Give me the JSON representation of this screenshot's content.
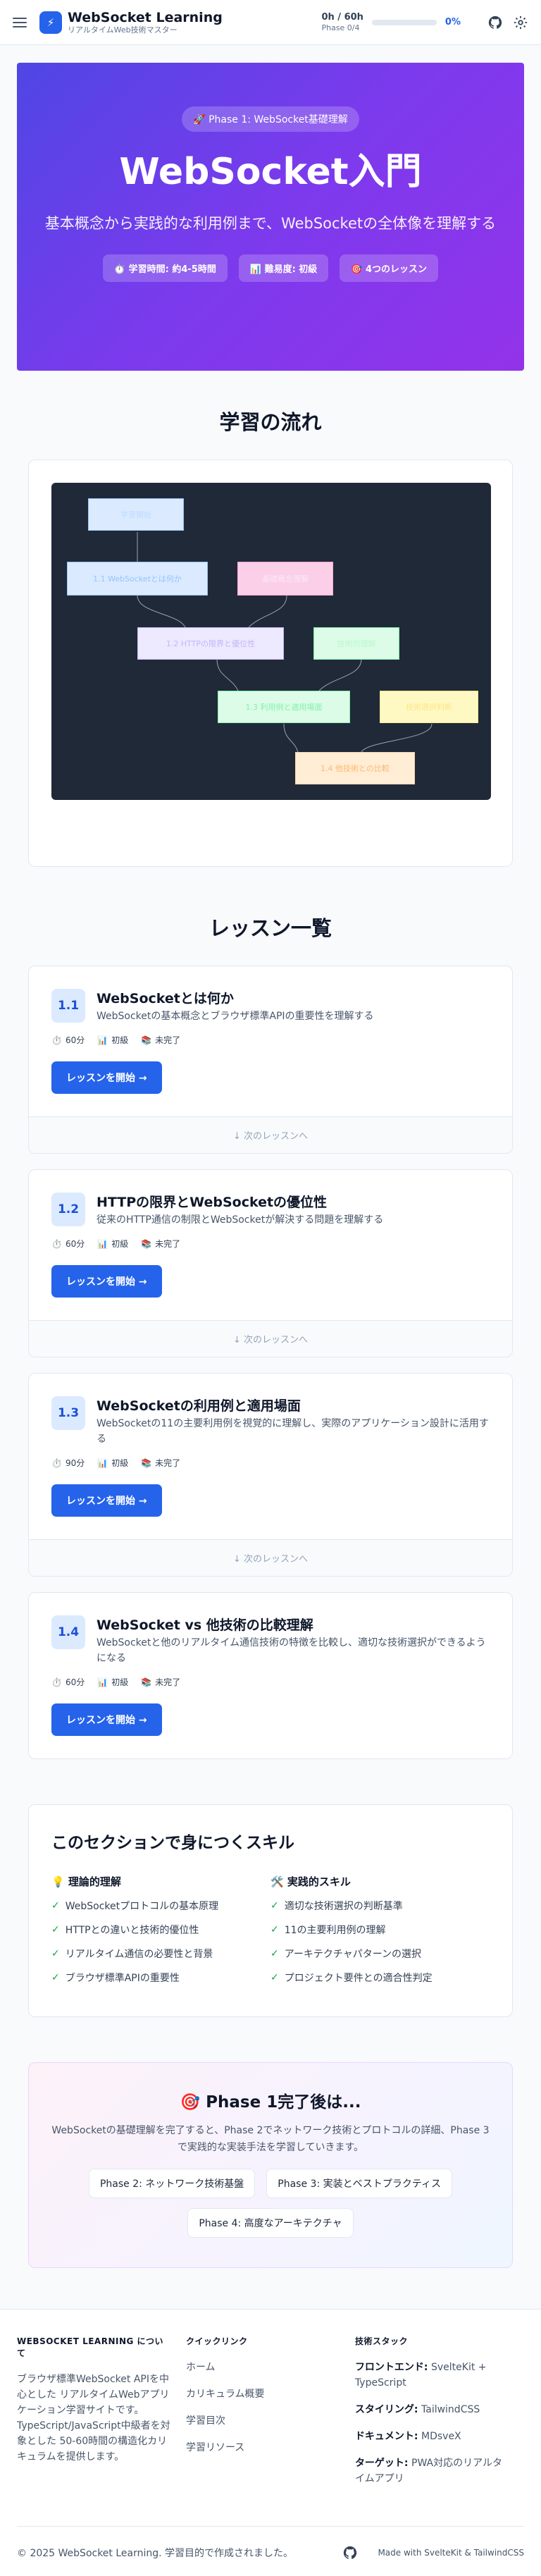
{
  "header": {
    "brand_title": "WebSocket Learning",
    "brand_sub": "リアルタイムWeb技術マスター",
    "hours": "0h / 60h",
    "phase": "Phase 0/4",
    "progress_pct": 0,
    "progress_label": "0%",
    "icons": [
      "menu-icon",
      "bolt-icon",
      "github-icon",
      "gear-icon"
    ]
  },
  "hero": {
    "badge": "🚀 Phase 1: WebSocket基礎理解",
    "title": "WebSocket入門",
    "subtitle": "基本概念から実践的な利用例まで、WebSocketの全体像を理解する",
    "stats": [
      "⏱️ 学習時間: 約4-5時間",
      "📊 難易度: 初級",
      "🎯 4つのレッスン"
    ]
  },
  "flow": {
    "title": "学習の流れ",
    "nodes": [
      "学習開始",
      "1.1 WebSocketとは何か",
      "基礎概念理解",
      "1.2 HTTPの限界と優位性",
      "技術的理解",
      "1.3 利用例と適用場面",
      "技術選択判断",
      "1.4 他技術との比較"
    ]
  },
  "lessons_section_title": "レッスン一覧",
  "lessons": [
    {
      "num": "1.1",
      "title": "WebSocketとは何か",
      "desc": "WebSocketの基本概念とブラウザ標準APIの重要性を理解する",
      "time": "60分",
      "level": "初級",
      "status": "未完了",
      "button": "レッスンを開始 →",
      "next": "↓ 次のレッスンへ"
    },
    {
      "num": "1.2",
      "title": "HTTPの限界とWebSocketの優位性",
      "desc": "従来のHTTP通信の制限とWebSocketが解決する問題を理解する",
      "time": "60分",
      "level": "初級",
      "status": "未完了",
      "button": "レッスンを開始 →",
      "next": "↓ 次のレッスンへ"
    },
    {
      "num": "1.3",
      "title": "WebSocketの利用例と適用場面",
      "desc": "WebSocketの11の主要利用例を視覚的に理解し、実際のアプリケーション設計に活用する",
      "time": "90分",
      "level": "初級",
      "status": "未完了",
      "button": "レッスンを開始 →",
      "next": "↓ 次のレッスンへ"
    },
    {
      "num": "1.4",
      "title": "WebSocket vs 他技術の比較理解",
      "desc": "WebSocketと他のリアルタイム通信技術の特徴を比較し、適切な技術選択ができるようになる",
      "time": "60分",
      "level": "初級",
      "status": "未完了",
      "button": "レッスンを開始 →",
      "next": ""
    }
  ],
  "skills": {
    "title": "このセクションで身につくスキル",
    "theory_title": "💡 理論的理解",
    "theory": [
      "WebSocketプロトコルの基本原理",
      "HTTPとの違いと技術的優位性",
      "リアルタイム通信の必要性と背景",
      "ブラウザ標準APIの重要性"
    ],
    "practical_title": "🛠️ 実践的スキル",
    "practical": [
      "適切な技術選択の判断基準",
      "11の主要利用例の理解",
      "アーキテクチャパターンの選択",
      "プロジェクト要件との適合性判定"
    ]
  },
  "phase_complete": {
    "title": "🎯 Phase 1完了後は...",
    "desc": "WebSocketの基礎理解を完了すると、Phase 2でネットワーク技術とプロトコルの詳細、Phase 3で実践的な実装手法を学習していきます。",
    "pills": [
      "Phase 2: ネットワーク技術基盤",
      "Phase 3: 実装とベストプラクティス",
      "Phase 4: 高度なアーキテクチャ"
    ]
  },
  "footer": {
    "about_title": "WEBSOCKET LEARNING について",
    "about_text": "ブラウザ標準WebSocket APIを中心とした リアルタイムWebアプリケーション学習サイトです。 TypeScript/JavaScript中級者を対象とした 50-60時間の構造化カリキュラムを提供します。",
    "links_title": "クイックリンク",
    "links": [
      "ホーム",
      "カリキュラム概要",
      "学習目次",
      "学習リソース"
    ],
    "tech_title": "技術スタック",
    "tech": [
      {
        "label": "フロントエンド:",
        "value": "SvelteKit + TypeScript"
      },
      {
        "label": "スタイリング:",
        "value": "TailwindCSS"
      },
      {
        "label": "ドキュメント:",
        "value": "MDsveX"
      },
      {
        "label": "ターゲット:",
        "value": "PWA対応のリアルタイムアプリ"
      }
    ],
    "copyright": "© 2025 WebSocket Learning. 学習目的で作成されました。",
    "made_with": "Made with SvelteKit & TailwindCSS"
  }
}
